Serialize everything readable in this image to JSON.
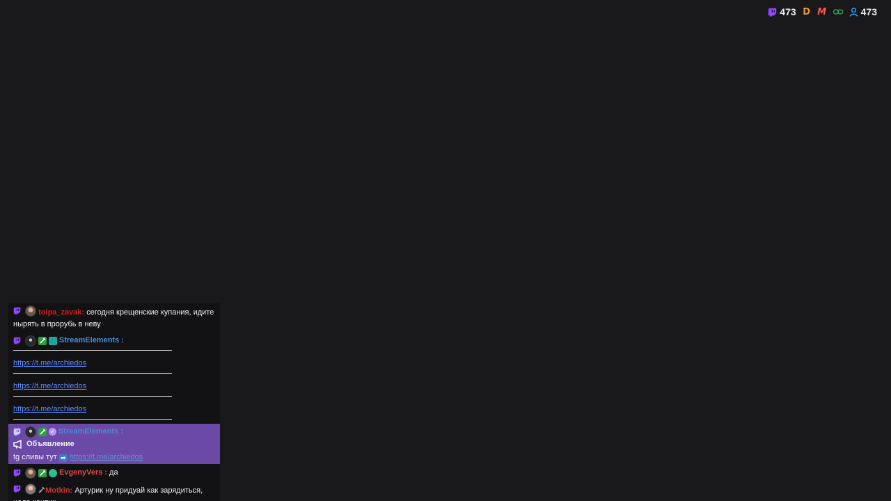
{
  "stats": {
    "twitch_count": "473",
    "viewer_count": "473",
    "colors": {
      "twitch": "#9146ff",
      "d_logo": "#e8973a",
      "m_logo": "#ff5a4e",
      "link_icon": "#2e9e5b",
      "viewer": "#3aa0ff"
    }
  },
  "chat": {
    "messages": [
      {
        "username": "toipa_zavak",
        "username_color": "#d41e1e",
        "text": "сегодня крещенские купания, идите нырять в прорубь в неву"
      },
      {
        "username": "StreamElements",
        "username_color": "#4a8bd9",
        "links": [
          "https://t.me/archiedos",
          "https://t.me/archiedos",
          "https://t.me/archiedos"
        ]
      },
      {
        "username": "StreamElements",
        "username_color": "#4a8bd9",
        "announcement_label": "Объявление",
        "text": "tg сливы тут",
        "link": "https://t.me/archiedos"
      },
      {
        "username": "EvgenyVers",
        "username_color": "#e04b4b",
        "text": "да"
      },
      {
        "username": "Motkin",
        "username_color": "#c83a3a",
        "text": "Артурик ну придуай как зарядиться, надо контик"
      }
    ]
  }
}
